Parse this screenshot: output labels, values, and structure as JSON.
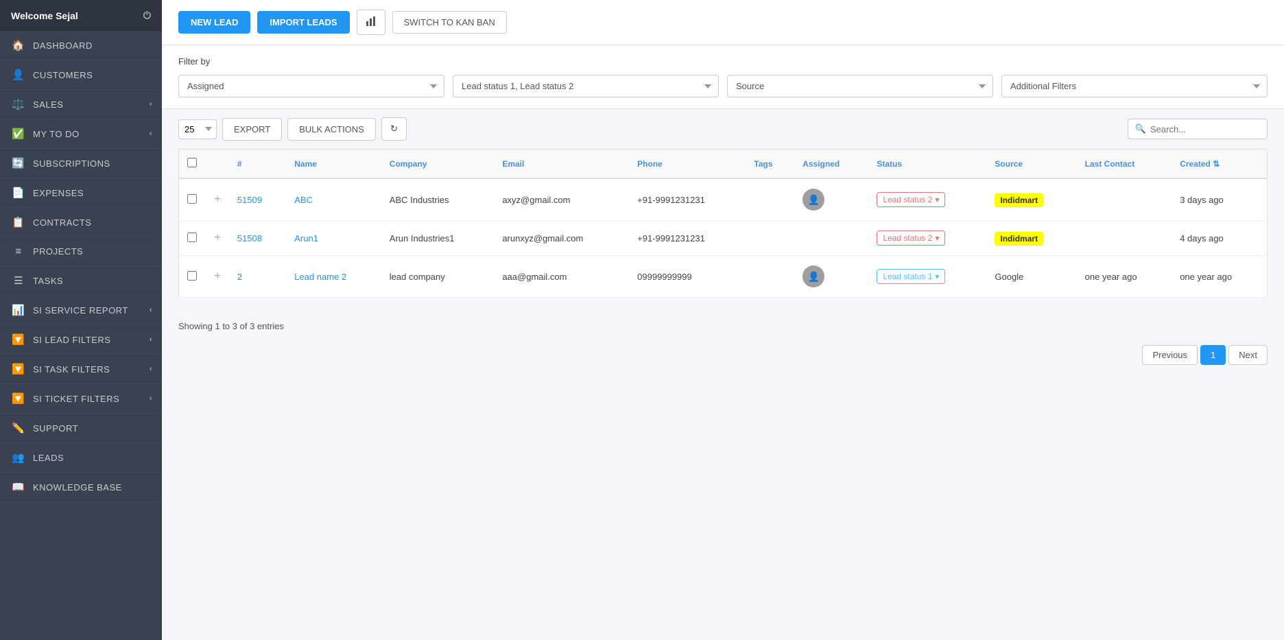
{
  "sidebar": {
    "user": "Welcome Sejal",
    "items": [
      {
        "id": "dashboard",
        "label": "DASHBOARD",
        "icon": "🏠",
        "hasChevron": false
      },
      {
        "id": "customers",
        "label": "CUSTOMERS",
        "icon": "👤",
        "hasChevron": false
      },
      {
        "id": "sales",
        "label": "SALES",
        "icon": "⚖️",
        "hasChevron": true
      },
      {
        "id": "my-to-do",
        "label": "MY TO DO",
        "icon": "✅",
        "hasChevron": true
      },
      {
        "id": "subscriptions",
        "label": "SUBSCRIPTIONS",
        "icon": "🔄",
        "hasChevron": false
      },
      {
        "id": "expenses",
        "label": "EXPENSES",
        "icon": "📄",
        "hasChevron": false
      },
      {
        "id": "contracts",
        "label": "CONTRACTS",
        "icon": "📋",
        "hasChevron": false
      },
      {
        "id": "projects",
        "label": "PROJECTS",
        "icon": "≡",
        "hasChevron": false
      },
      {
        "id": "tasks",
        "label": "TASKS",
        "icon": "☰",
        "hasChevron": false
      },
      {
        "id": "si-service-report",
        "label": "SI SERVICE REPORT",
        "icon": "📊",
        "hasChevron": true
      },
      {
        "id": "si-lead-filters",
        "label": "SI LEAD FILTERS",
        "icon": "🔽",
        "hasChevron": true
      },
      {
        "id": "si-task-filters",
        "label": "SI TASK FILTERS",
        "icon": "🔽",
        "hasChevron": true
      },
      {
        "id": "si-ticket-filters",
        "label": "SI TICKET FILTERS",
        "icon": "🔽",
        "hasChevron": true
      },
      {
        "id": "support",
        "label": "SUPPORT",
        "icon": "✏️",
        "hasChevron": false
      },
      {
        "id": "leads",
        "label": "LEADS",
        "icon": "👥",
        "hasChevron": false
      },
      {
        "id": "knowledge-base",
        "label": "KNOWLEDGE BASE",
        "icon": "📖",
        "hasChevron": false
      }
    ]
  },
  "toolbar": {
    "new_lead_label": "NEW LEAD",
    "import_leads_label": "IMPORT LEADS",
    "switch_kanban_label": "SWITCH TO KAN BAN"
  },
  "filters": {
    "label": "Filter by",
    "assigned_placeholder": "Assigned",
    "status_value": "Lead status 1, Lead status 2",
    "source_placeholder": "Source",
    "additional_placeholder": "Additional Filters"
  },
  "table_controls": {
    "page_size": "25",
    "export_label": "EXPORT",
    "bulk_actions_label": "BULK ACTIONS",
    "search_placeholder": "Search..."
  },
  "table": {
    "headers": [
      "#",
      "Name",
      "Company",
      "Email",
      "Phone",
      "Tags",
      "Assigned",
      "Status",
      "Source",
      "Last Contact",
      "Created"
    ],
    "rows": [
      {
        "id": "51509",
        "name": "ABC",
        "company": "ABC Industries",
        "email": "axyz@gmail.com",
        "phone": "+91-9991231231",
        "tags": "",
        "assigned": "avatar",
        "status": "Lead status 2",
        "status_type": "status2",
        "source": "Indidmart",
        "source_type": "badge",
        "last_contact": "",
        "created": "3 days ago"
      },
      {
        "id": "51508",
        "name": "Arun1",
        "company": "Arun Industries1",
        "email": "arunxyz@gmail.com",
        "phone": "+91-9991231231",
        "tags": "",
        "assigned": "",
        "status": "Lead status 2",
        "status_type": "status2",
        "source": "Indidmart",
        "source_type": "badge",
        "last_contact": "",
        "created": "4 days ago"
      },
      {
        "id": "2",
        "name": "Lead name 2",
        "company": "lead company",
        "email": "aaa@gmail.com",
        "phone": "09999999999",
        "tags": "",
        "assigned": "avatar",
        "status": "Lead status 1",
        "status_type": "status1",
        "source": "Google",
        "source_type": "text",
        "last_contact": "one year ago",
        "created": "one year ago"
      }
    ]
  },
  "pagination": {
    "showing_text": "Showing 1 to 3 of 3 entries",
    "prev_label": "Previous",
    "current_page": "1",
    "next_label": "Next"
  }
}
